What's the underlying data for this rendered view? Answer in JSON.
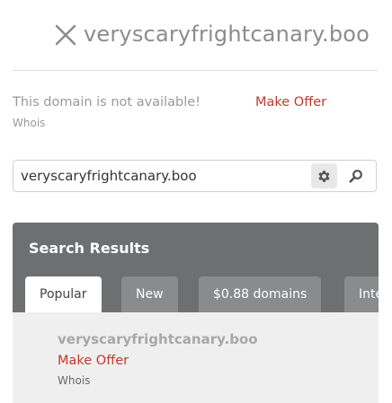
{
  "header": {
    "domain": "veryscaryfrightcanary.boo",
    "close_icon": "close-icon"
  },
  "availability": {
    "status_text": "This domain is not available!",
    "make_offer": "Make Offer",
    "whois": "Whois"
  },
  "search": {
    "value": "veryscaryfrightcanary.boo",
    "gear_icon": "gear-icon",
    "search_icon": "search-icon"
  },
  "results": {
    "title": "Search Results",
    "tabs": [
      {
        "label": "Popular",
        "active": true
      },
      {
        "label": "New",
        "active": false
      },
      {
        "label": "$0.88 domains",
        "active": false
      },
      {
        "label": "International",
        "active": false
      }
    ],
    "items": [
      {
        "domain": "veryscaryfrightcanary.boo",
        "action": "Make Offer",
        "whois": "Whois"
      }
    ]
  },
  "colors": {
    "accent_red": "#c0392b",
    "panel_dark": "#6e6f71",
    "tab_inactive": "#8a8b8d"
  }
}
